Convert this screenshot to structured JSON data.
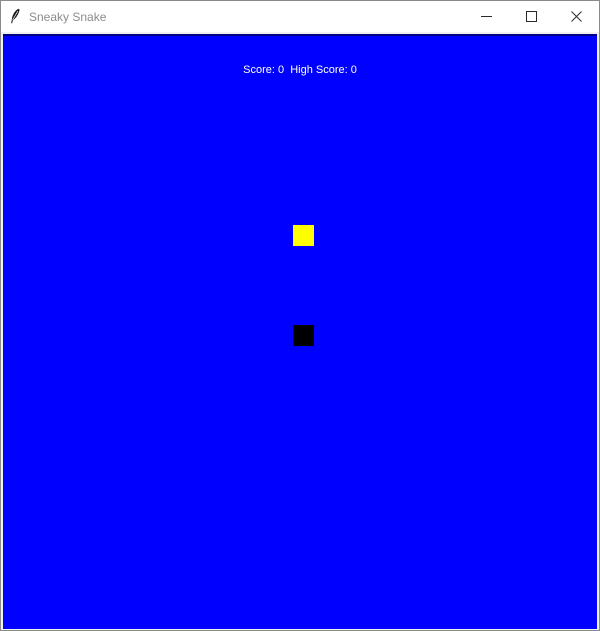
{
  "window": {
    "title": "Sneaky Snake",
    "buttons": {
      "minimize": "minimize",
      "maximize": "maximize",
      "close": "close"
    }
  },
  "game": {
    "score_text": "Score: 0  High Score: 0",
    "score": 0,
    "high_score": 0,
    "colors": {
      "background": "#0000ff",
      "food": "#ffff00",
      "snake": "#000000",
      "text": "#ffffff"
    },
    "icons": {
      "app": "feather-icon",
      "food": "food-square",
      "snake": "snake-head-square"
    }
  }
}
